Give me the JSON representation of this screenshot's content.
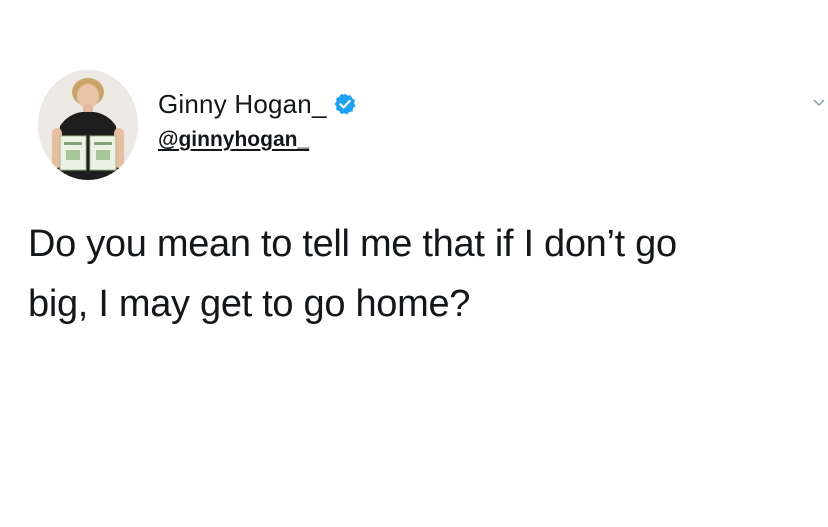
{
  "author": {
    "display_name": "Ginny Hogan_",
    "handle": "@ginnyhogan_",
    "verified": true,
    "verified_color": "#1da1f2"
  },
  "tweet": {
    "text_line_1": "Do you mean to tell me that if I don’t go",
    "text_line_2": "big, I may get to go home?"
  },
  "icons": {
    "avatar": "profile-photo",
    "verified": "verified-badge-icon",
    "menu": "chevron-down-icon"
  }
}
